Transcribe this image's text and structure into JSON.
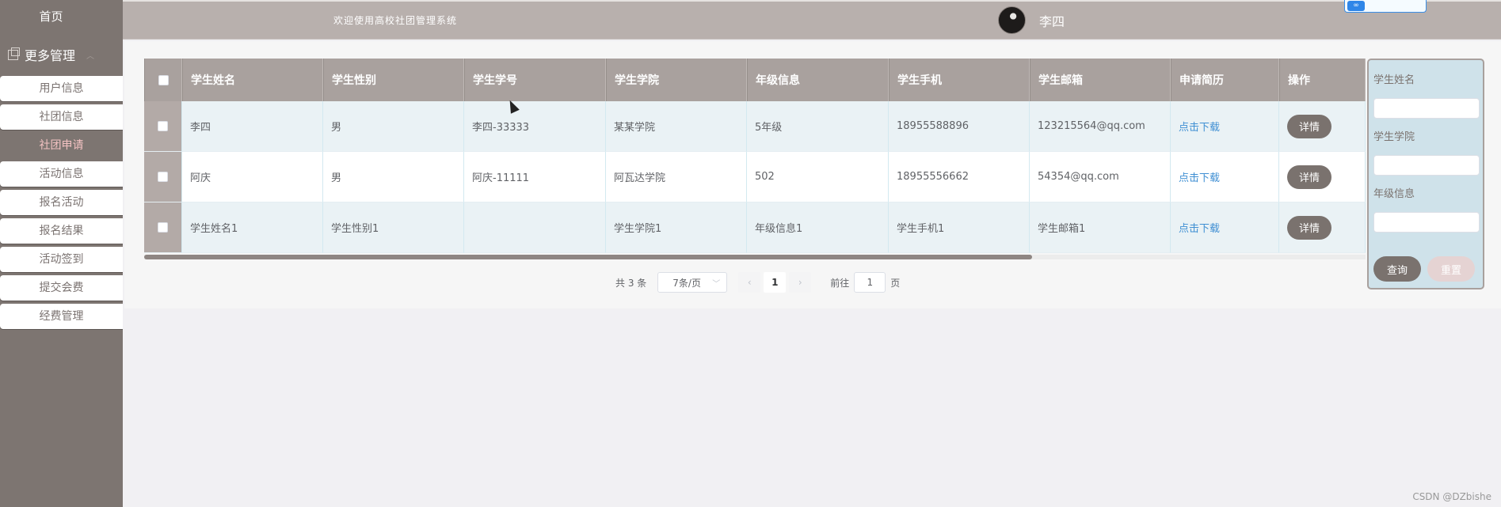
{
  "sidebar": {
    "home": "首页",
    "group": "更多管理",
    "items": [
      "用户信息",
      "社团信息",
      "社团申请",
      "活动信息",
      "报名活动",
      "报名结果",
      "活动签到",
      "提交会费",
      "经费管理"
    ]
  },
  "header": {
    "welcome": "欢迎使用高校社团管理系统",
    "username": "李四"
  },
  "table": {
    "columns": [
      "学生姓名",
      "学生性别",
      "学生学号",
      "学生学院",
      "年级信息",
      "学生手机",
      "学生邮箱",
      "申请简历",
      "操作"
    ],
    "rows": [
      {
        "name": "李四",
        "sex": "男",
        "no": "李四-33333",
        "college": "某某学院",
        "grade": "5年级",
        "phone": "18955588896",
        "email": "123215564@qq.com",
        "cv": "点击下载",
        "op": "详情"
      },
      {
        "name": "阿庆",
        "sex": "男",
        "no": "阿庆-11111",
        "college": "阿瓦达学院",
        "grade": "502",
        "phone": "18955556662",
        "email": "54354@qq.com",
        "cv": "点击下载",
        "op": "详情"
      },
      {
        "name": "学生姓名1",
        "sex": "学生性别1",
        "no": "",
        "college": "学生学院1",
        "grade": "年级信息1",
        "phone": "学生手机1",
        "email": "学生邮箱1",
        "cv": "点击下载",
        "op": "详情"
      }
    ]
  },
  "pager": {
    "total": "共 3 条",
    "size": "7条/页",
    "current": "1",
    "goto_prefix": "前往",
    "goto_value": "1",
    "goto_suffix": "页"
  },
  "search": {
    "name_label": "学生姓名",
    "college_label": "学生学院",
    "grade_label": "年级信息",
    "query": "查询",
    "reset": "重置"
  },
  "watermark": "CSDN @DZbishe",
  "colors": {
    "sidebar": "#7d7571",
    "header": "#b8b0ad",
    "table_header": "#a9a19e",
    "button": "#7a726e",
    "link": "#3f8fd3"
  }
}
